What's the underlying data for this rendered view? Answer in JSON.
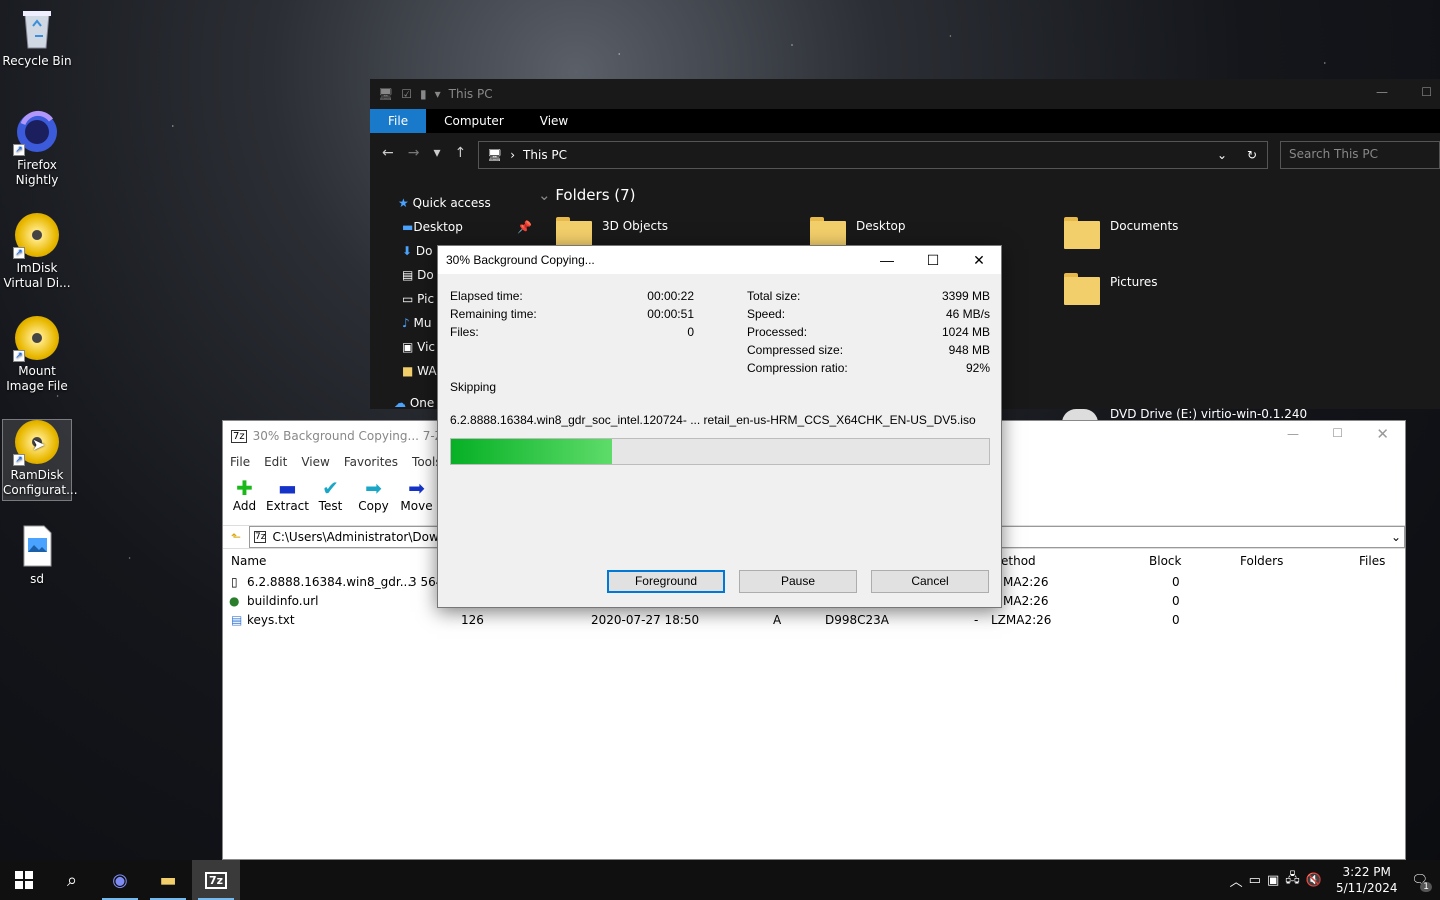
{
  "desktop": {
    "icons": [
      {
        "label": "Recycle Bin",
        "icon": "recycle-bin-icon"
      },
      {
        "label": "Firefox Nightly",
        "icon": "firefox-nightly-icon"
      },
      {
        "label": "ImDisk Virtual Di...",
        "icon": "imdisk-icon"
      },
      {
        "label": "Mount Image File",
        "icon": "mount-image-icon"
      },
      {
        "label": "RamDisk Configurat...",
        "icon": "ramdisk-icon"
      },
      {
        "label": "sd",
        "icon": "image-file-icon"
      }
    ]
  },
  "explorer": {
    "title": "This PC",
    "tabs": [
      "File",
      "Computer",
      "View"
    ],
    "breadcrumb": "This PC",
    "search_placeholder": "Search This PC",
    "nav": {
      "quick_access": "Quick access",
      "items": [
        "Desktop",
        "Do",
        "Do",
        "Pic",
        "Mu",
        "Vic",
        "WA"
      ],
      "onedrive": "One"
    },
    "folders_header": "Folders (7)",
    "folders": [
      "3D Objects",
      "Desktop",
      "Documents",
      "Pictures"
    ],
    "drive": "DVD Drive (E:) virtio-win-0.1.240"
  },
  "zip": {
    "title": "30% Background Copying... 7-Zip",
    "menu": [
      "File",
      "Edit",
      "View",
      "Favorites",
      "Tools"
    ],
    "toolbar": [
      "Add",
      "Extract",
      "Test",
      "Copy",
      "Move"
    ],
    "path": "C:\\Users\\Administrator\\Down",
    "columns": {
      "name": "Name",
      "method": "ethod",
      "block": "Block",
      "folders": "Folders",
      "files": "Files"
    },
    "rows": [
      {
        "name": "6.2.8888.16384.win8_gdr...",
        "size": "3 564",
        "date": "",
        "attr": "",
        "crc": "",
        "dash": "",
        "method": "MA2:26",
        "block": "0"
      },
      {
        "name": "buildinfo.url",
        "size": "",
        "date": "",
        "attr": "",
        "crc": "",
        "dash": "",
        "method": "MA2:26",
        "block": "0"
      },
      {
        "name": "keys.txt",
        "size": "126",
        "date": "2020-07-27 18:50",
        "attr": "A",
        "crc": "D998C23A",
        "dash": "-",
        "method": "LZMA2:26",
        "block": "0"
      }
    ]
  },
  "dialog": {
    "title": "30% Background Copying...",
    "left": [
      {
        "k": "Elapsed time:",
        "v": "00:00:22"
      },
      {
        "k": "Remaining time:",
        "v": "00:00:51"
      },
      {
        "k": "Files:",
        "v": "0"
      }
    ],
    "right": [
      {
        "k": "Total size:",
        "v": "3399 MB"
      },
      {
        "k": "Speed:",
        "v": "46 MB/s"
      },
      {
        "k": "Processed:",
        "v": "1024 MB"
      },
      {
        "k": "Compressed size:",
        "v": "948 MB"
      },
      {
        "k": "Compression ratio:",
        "v": "92%"
      }
    ],
    "status": "Skipping",
    "file": "6.2.8888.16384.win8_gdr_soc_intel.120724- ... retail_en-us-HRM_CCS_X64CHK_EN-US_DV5.iso",
    "progress": 0.3,
    "buttons": {
      "foreground": "Foreground",
      "pause": "Pause",
      "cancel": "Cancel"
    }
  },
  "taskbar": {
    "time": "3:22 PM",
    "date": "5/11/2024",
    "notif_count": "1"
  },
  "colors": {
    "progress": "#06b025",
    "accent": "#1979ca"
  }
}
